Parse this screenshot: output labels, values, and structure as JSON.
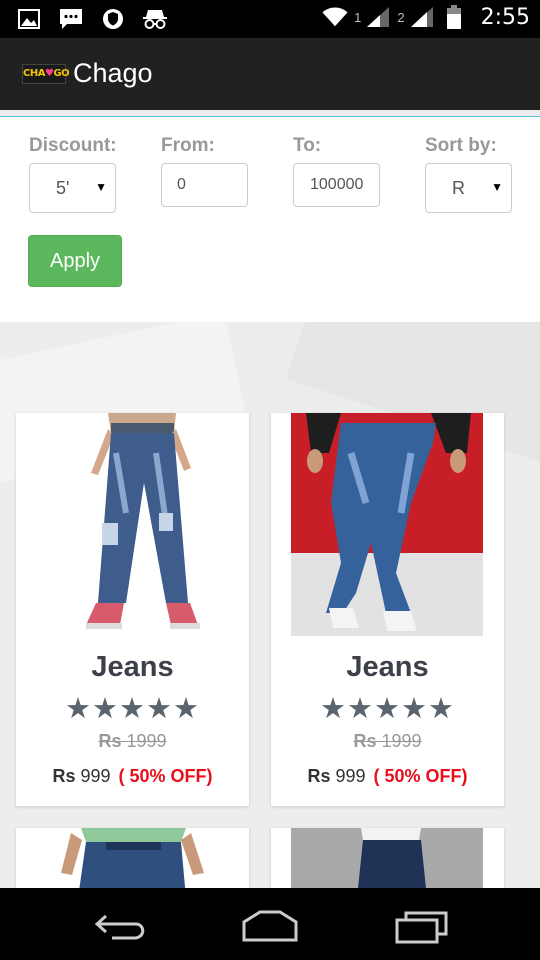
{
  "status_bar": {
    "sim1": "1",
    "sim2": "2",
    "time": "2:55",
    "icons": [
      "picture-icon",
      "message-icon",
      "vpn-shield-icon",
      "incognito-icon",
      "wifi-icon",
      "signal-icon",
      "battery-icon"
    ]
  },
  "app_bar": {
    "logo_text_left": "CHA",
    "logo_text_right": "GO",
    "title": "Chago"
  },
  "filters": {
    "discount": {
      "label": "Discount:",
      "value": "5'"
    },
    "from": {
      "label": "From:",
      "value": "0"
    },
    "to": {
      "label": "To:",
      "value": "100000"
    },
    "sort": {
      "label": "Sort by:",
      "value": "R"
    },
    "apply_label": "Apply"
  },
  "products": [
    {
      "name": "Jeans",
      "stars": "★★★★★",
      "old_currency": "Rs",
      "old_price": " 1999",
      "currency": "Rs",
      "price": " 999",
      "discount": "( 50% OFF)"
    },
    {
      "name": "Jeans",
      "stars": "★★★★★",
      "old_currency": "Rs",
      "old_price": " 1999",
      "currency": "Rs",
      "price": " 999",
      "discount": "( 50% OFF)"
    }
  ],
  "colors": {
    "accent": "#5cb85c",
    "divider": "#5bc0de",
    "discount": "#e8101c",
    "appbar": "#212121"
  }
}
